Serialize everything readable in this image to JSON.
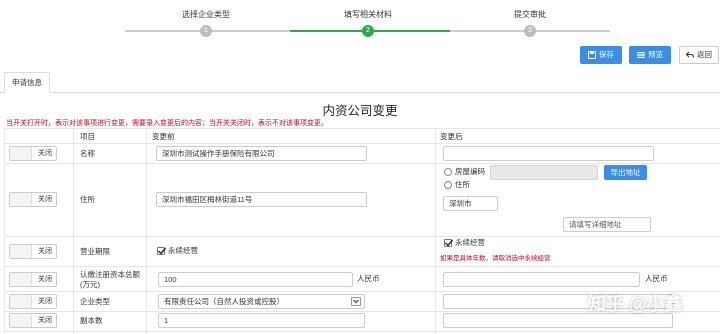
{
  "steps": [
    {
      "label": "选择企业类型",
      "number": "1",
      "state": "done"
    },
    {
      "label": "填写相关材料",
      "number": "2",
      "state": "active"
    },
    {
      "label": "提交审批",
      "number": "3",
      "state": "todo"
    }
  ],
  "colors": {
    "active": "#2fa84f",
    "inactive": "#cccccc",
    "primary": "#3a8ee6",
    "danger": "#d9001b"
  },
  "toolbar": {
    "save_label": "保存",
    "preview_label": "预览",
    "back_label": "返回"
  },
  "tab": {
    "label": "申请信息"
  },
  "title": "内资公司变更",
  "notice": "当开关打开时，表示对该事项进行变更，需要录入变更后的内容；当开关关闭时，表示不对该事项变更。",
  "headers": {
    "item": "项目",
    "before": "变更前",
    "after": "变更后"
  },
  "toggle_label": "关闭",
  "rows": {
    "name": {
      "label": "名称",
      "before": "深圳市测试操作手册保险有限公司",
      "after": ""
    },
    "address": {
      "label": "住所",
      "before": "深圳市福田区梅林街道11号",
      "option_house_code": "房屋编码",
      "option_address": "住所",
      "export_button": "导出地址",
      "city": "深圳市",
      "detail_placeholder": "请填写详细地址"
    },
    "term": {
      "label": "营业期限",
      "before_check": "永续经营",
      "after_check": "永续经营",
      "hint": "如果是具体年数，请取消选中永续经营"
    },
    "capital": {
      "label_line1": "认缴注册资本总额",
      "label_line2": "(万元)",
      "before": "100",
      "unit_before": "人民币",
      "after": "",
      "unit_after": "人民币"
    },
    "type": {
      "label": "企业类型",
      "before": "有限责任公司（自然人投资或控股）",
      "after": ""
    },
    "copies": {
      "label": "副本数",
      "before": "1",
      "after": ""
    }
  },
  "watermark": "知乎 @小鑫"
}
